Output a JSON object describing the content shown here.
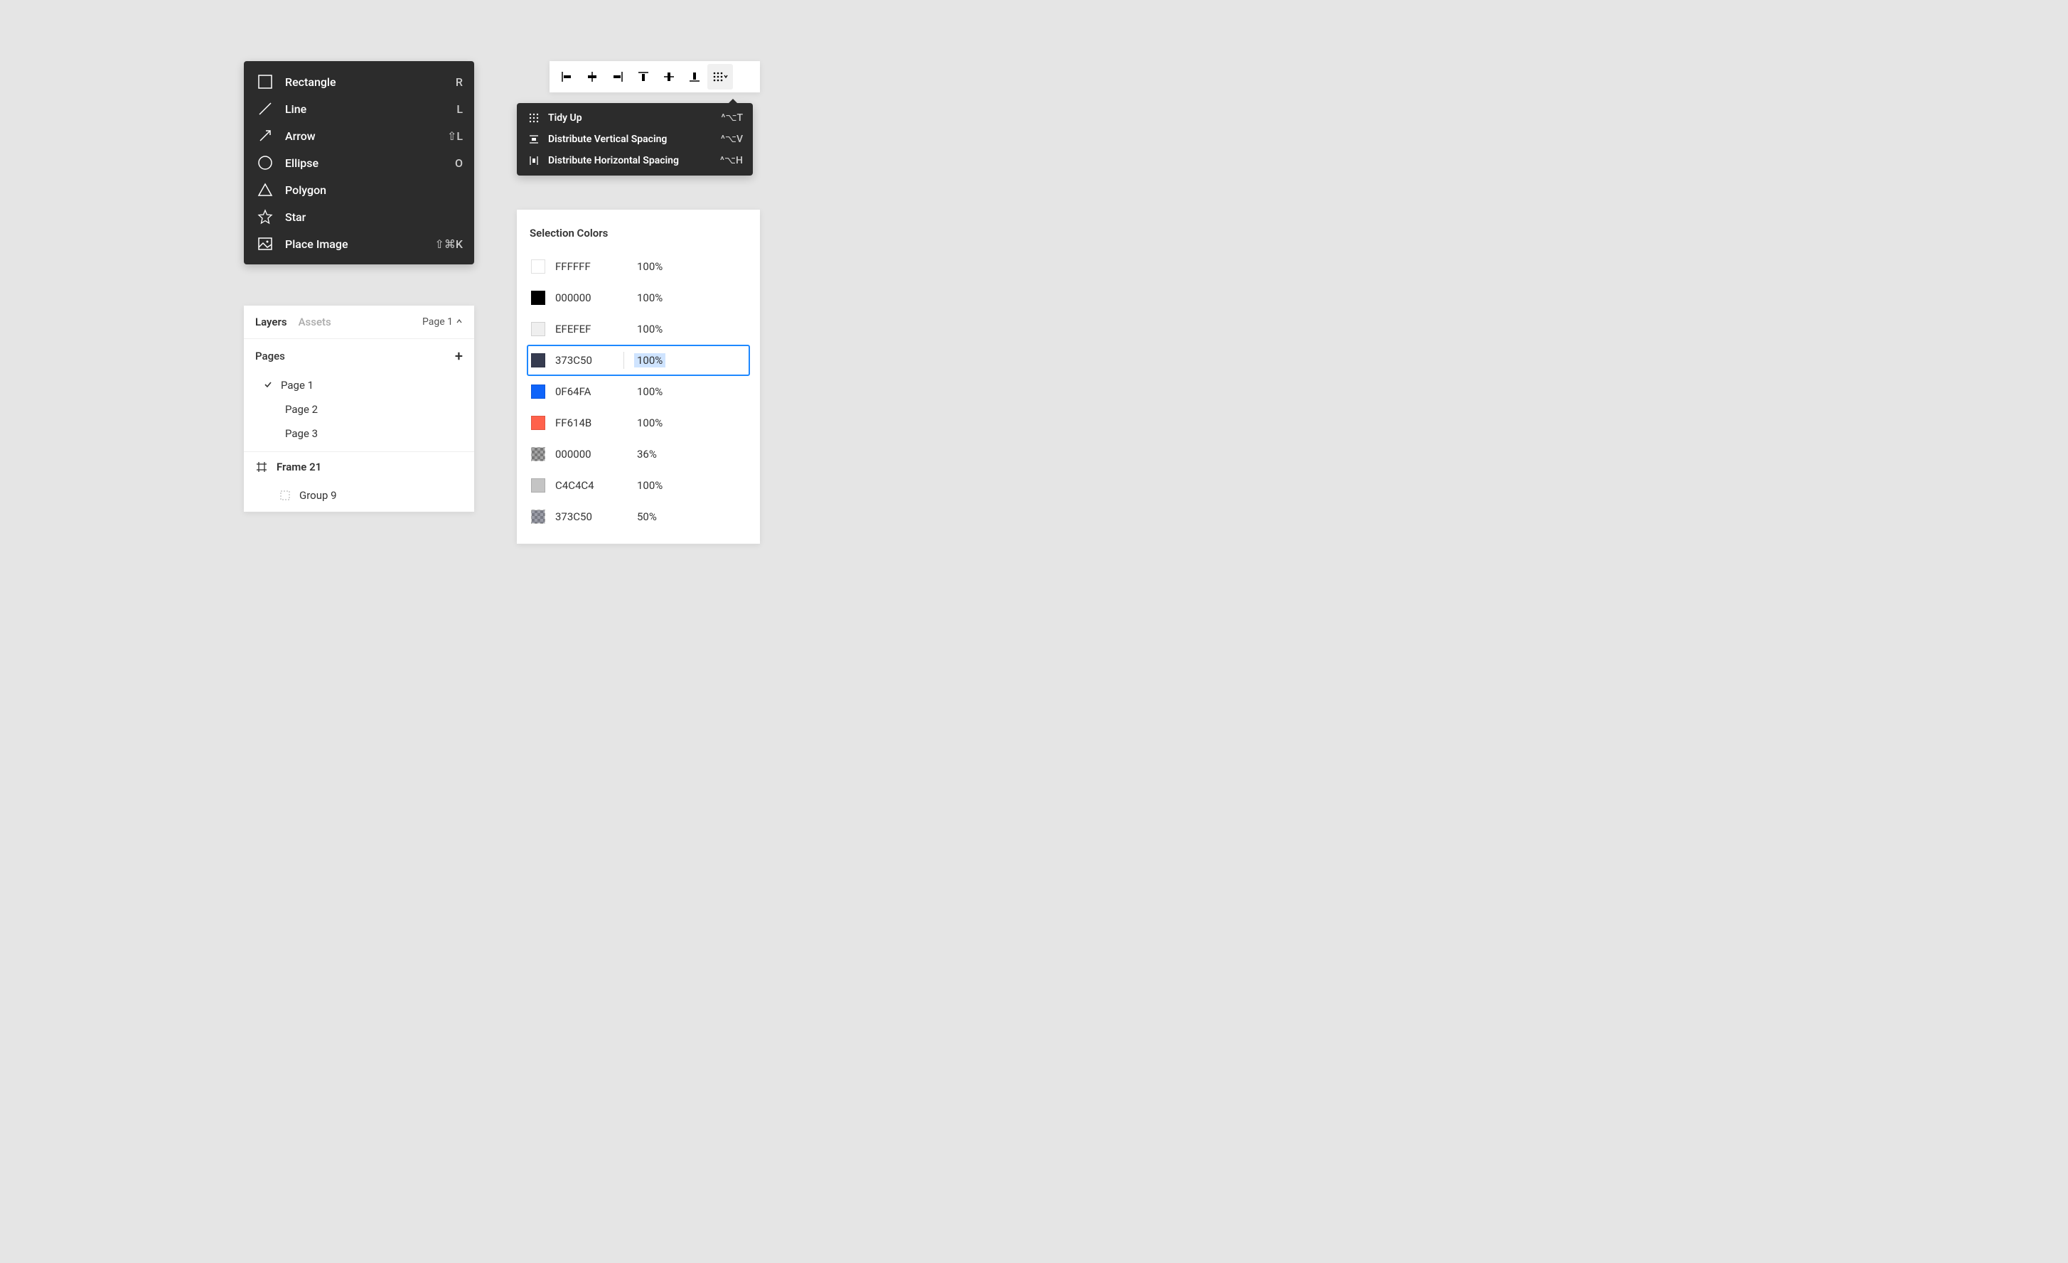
{
  "shape_menu": {
    "items": [
      {
        "label": "Rectangle",
        "shortcut": "R",
        "icon": "rectangle-icon"
      },
      {
        "label": "Line",
        "shortcut": "L",
        "icon": "line-icon"
      },
      {
        "label": "Arrow",
        "shortcut": "⇧L",
        "icon": "arrow-icon"
      },
      {
        "label": "Ellipse",
        "shortcut": "O",
        "icon": "ellipse-icon"
      },
      {
        "label": "Polygon",
        "shortcut": "",
        "icon": "polygon-icon"
      },
      {
        "label": "Star",
        "shortcut": "",
        "icon": "star-icon"
      },
      {
        "label": "Place Image",
        "shortcut": "⇧⌘K",
        "icon": "image-icon"
      }
    ]
  },
  "align_toolbar": {
    "buttons": [
      "align-left-icon",
      "align-hcenter-icon",
      "align-right-icon",
      "align-top-icon",
      "align-vcenter-icon",
      "align-bottom-icon",
      "distribute-more-icon"
    ],
    "active_index": 6
  },
  "distribute_menu": {
    "items": [
      {
        "label": "Tidy Up",
        "shortcut": "^⌥T",
        "icon": "tidy-icon"
      },
      {
        "label": "Distribute Vertical Spacing",
        "shortcut": "^⌥V",
        "icon": "dist-v-icon"
      },
      {
        "label": "Distribute Horizontal Spacing",
        "shortcut": "^⌥H",
        "icon": "dist-h-icon"
      }
    ]
  },
  "layers_panel": {
    "tabs": {
      "layers": "Layers",
      "assets": "Assets"
    },
    "page_selector": "Page 1",
    "pages_header": "Pages",
    "pages": [
      {
        "label": "Page 1",
        "checked": true
      },
      {
        "label": "Page 2",
        "checked": false
      },
      {
        "label": "Page 3",
        "checked": false
      }
    ],
    "frame": "Frame 21",
    "group": "Group 9"
  },
  "colors_panel": {
    "title": "Selection Colors",
    "rows": [
      {
        "hex": "FFFFFF",
        "opacity": "100%",
        "color": "#FFFFFF",
        "selected": false,
        "checker": false
      },
      {
        "hex": "000000",
        "opacity": "100%",
        "color": "#000000",
        "selected": false,
        "checker": false
      },
      {
        "hex": "EFEFEF",
        "opacity": "100%",
        "color": "#EFEFEF",
        "selected": false,
        "checker": false
      },
      {
        "hex": "373C50",
        "opacity": "100%",
        "color": "#373C50",
        "selected": true,
        "checker": false
      },
      {
        "hex": "0F64FA",
        "opacity": "100%",
        "color": "#0F64FA",
        "selected": false,
        "checker": false
      },
      {
        "hex": "FF614B",
        "opacity": "100%",
        "color": "#FF614B",
        "selected": false,
        "checker": false
      },
      {
        "hex": "000000",
        "opacity": "36%",
        "color": "#000000",
        "selected": false,
        "checker": true,
        "alpha": 0.36
      },
      {
        "hex": "C4C4C4",
        "opacity": "100%",
        "color": "#C4C4C4",
        "selected": false,
        "checker": false
      },
      {
        "hex": "373C50",
        "opacity": "50%",
        "color": "#373C50",
        "selected": false,
        "checker": true,
        "alpha": 0.5
      }
    ]
  }
}
